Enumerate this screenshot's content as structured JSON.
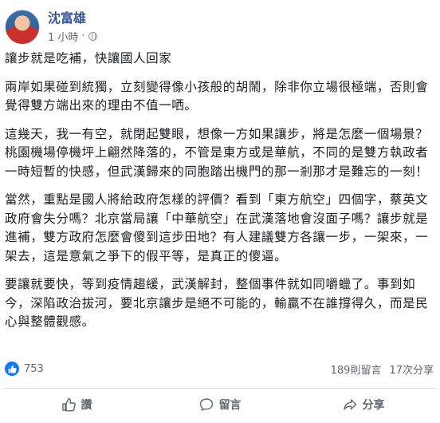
{
  "post": {
    "author": "沈富雄",
    "time": "1 小時",
    "separator": "·",
    "paragraphs": [
      "讓步就是吃補，快讓國人回家",
      "兩岸如果碰到統獨，立刻變得像小孩般的胡鬧，除非你立場很極端，否則會覺得雙方端出來的理由不值一哂。",
      "這幾天，我一有空，就閉起雙眼，想像一方如果讓步，將是怎麼一個場景？桃園機場停機坪上翩然降落的，不管是東方或是華航，不同的是雙方執政者\n一時短暫的快感，但武漢歸來的同胞踏出機門的那一剎那才是難忘的一刻！",
      "當然，重點是國人將給政府怎樣的評價？看到「東方航空」四個字，蔡英文政府會失分嗎？北京當局讓「中華航空」在武漢落地會沒面子嗎？讓步就是進補，雙方政府怎麼會傻到這步田地？有人建議雙方各讓一步，一架來，一架去，這是意氣之爭下的假平等，是真正的傻逼。",
      "要讓就要快，等到疫情趨緩，武漢解封，整個事件就如同嚼蠟了。事到如今，深陷政治拔河，要北京讓步是絕不可能的，輸贏不在誰撐得久，而是民心與整體觀感。"
    ]
  },
  "stats": {
    "likes": "753",
    "comments": "189則留言",
    "shares": "17次分享"
  },
  "actions": {
    "like": "讚",
    "comment": "留言",
    "share": "分享"
  },
  "colors": {
    "author": "#385898",
    "like_blue": "#1877f2",
    "secondary_text": "#606770"
  }
}
